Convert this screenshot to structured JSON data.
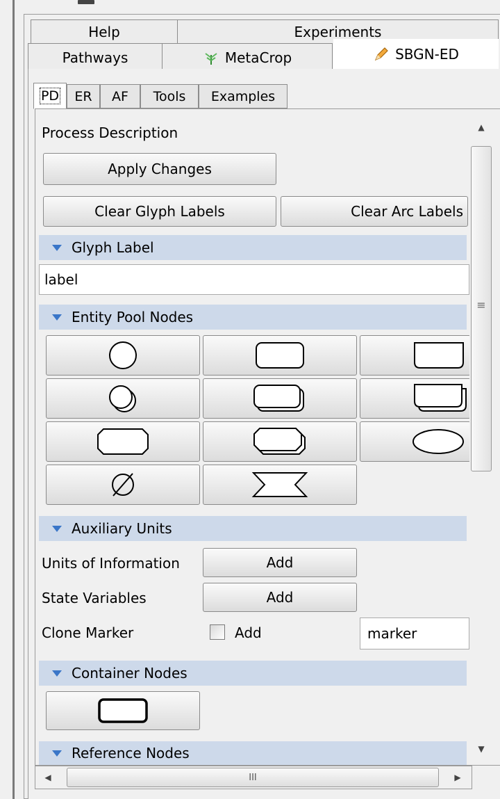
{
  "tabs_row1": [
    {
      "label": "Help"
    },
    {
      "label": "Experiments"
    }
  ],
  "tabs_row2": [
    {
      "label": "Pathways"
    },
    {
      "label": "MetaCrop",
      "icon": "plant-icon"
    },
    {
      "label": "SBGN-ED",
      "icon": "pencil-icon",
      "selected": true
    }
  ],
  "subtabs": [
    {
      "label": "PD",
      "selected": true
    },
    {
      "label": "ER"
    },
    {
      "label": "AF"
    },
    {
      "label": "Tools"
    },
    {
      "label": "Examples"
    }
  ],
  "panel": {
    "title": "Process Description",
    "apply_label": "Apply Changes",
    "clear_glyph_label": "Clear Glyph Labels",
    "clear_arc_label": "Clear Arc Labels"
  },
  "glyph_label": {
    "header": "Glyph Label",
    "value": "label"
  },
  "entity_pool": {
    "header": "Entity Pool Nodes",
    "glyphs": [
      "unspecified-entity-circle-icon",
      "macromolecule-rounded-rect-icon",
      "nucleic-acid-feature-icon",
      "simple-chemical-multimer-icon",
      "macromolecule-multimer-icon",
      "nucleic-acid-multimer-icon",
      "complex-octagon-icon",
      "complex-multimer-icon",
      "perturbing-agent-ellipse-icon",
      "source-sink-empty-set-icon",
      "perturbation-hourglass-icon"
    ]
  },
  "auxiliary": {
    "header": "Auxiliary Units",
    "units_label": "Units of Information",
    "units_button": "Add",
    "state_label": "State Variables",
    "state_button": "Add",
    "clone_label": "Clone Marker",
    "clone_checkbox_label": "Add",
    "clone_value": "marker"
  },
  "container": {
    "header": "Container Nodes",
    "glyph": "compartment-icon"
  },
  "reference": {
    "header": "Reference Nodes"
  },
  "hscroll_grip": "III"
}
